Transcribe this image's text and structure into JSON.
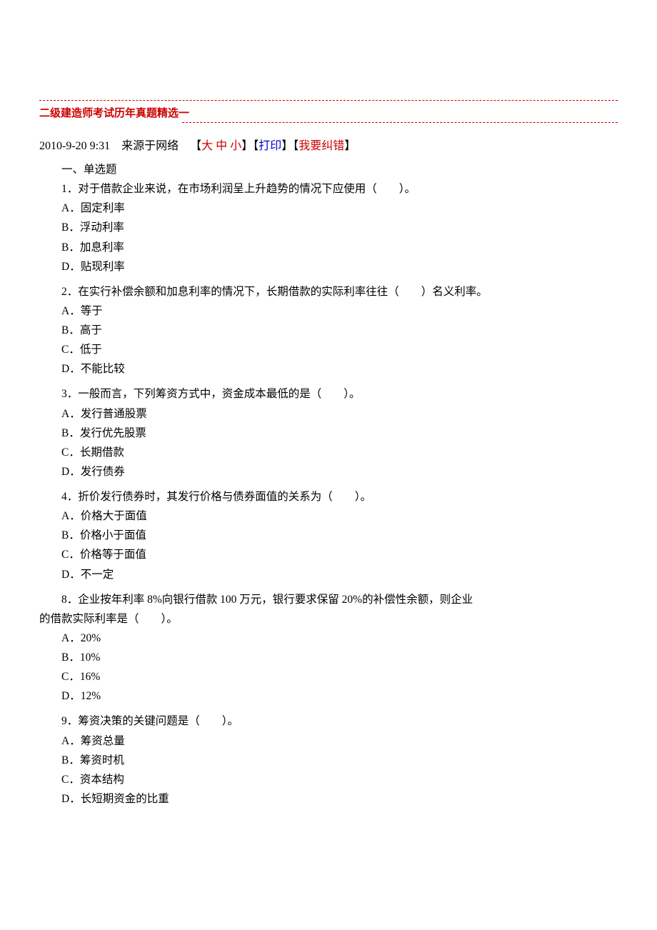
{
  "title": "二级建造师考试历年真题精选一",
  "meta": {
    "datetime": "2010-9-20 9:31",
    "source": "来源于网络",
    "size_large": "大",
    "size_medium": "中",
    "size_small": "小",
    "print": "打印",
    "correction": "我要纠错"
  },
  "section_heading": "一、单选题",
  "questions": [
    {
      "stem": "1．对于借款企业来说，在市场利润呈上升趋势的情况下应使用（　　）。",
      "options": [
        "A．固定利率",
        "B．浮动利率",
        "B．加息利率",
        "D．贴现利率"
      ]
    },
    {
      "stem": "2．在实行补偿余额和加息利率的情况下，长期借款的实际利率往往（　　）名义利率。",
      "options": [
        "A．等于",
        "B．高于",
        "C．低于",
        "D．不能比较"
      ]
    },
    {
      "stem": "3．一般而言，下列筹资方式中，资金成本最低的是（　　）。",
      "options": [
        "A．发行普通股票",
        "B．发行优先股票",
        "C．长期借款",
        "D．发行债券"
      ]
    },
    {
      "stem": "4．折价发行债券时，其发行价格与债券面值的关系为（　　）。",
      "options": [
        "A．价格大于面值",
        "B．价格小于面值",
        "C．价格等于面值",
        "D．不一定"
      ]
    },
    {
      "stem": "8．企业按年利率 8%向银行借款 100 万元，银行要求保留 20%的补偿性余额，则企业",
      "stem_cont": "的借款实际利率是（　　）。",
      "options": [
        "A．20%",
        "B．10%",
        "C．16%",
        "D．12%"
      ]
    },
    {
      "stem": "9．筹资决策的关键问题是（　　）。",
      "options": [
        "A．筹资总量",
        "B．筹资时机",
        "C．资本结构",
        "D．长短期资金的比重"
      ]
    }
  ]
}
